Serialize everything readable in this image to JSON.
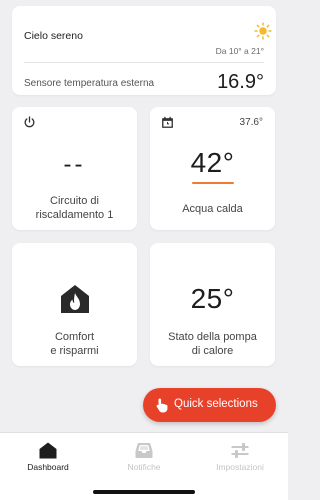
{
  "weather": {
    "condition": "Cielo sereno",
    "range": "Da 10° a 21°",
    "sensor_label": "Sensore temperatura esterna",
    "sensor_value": "16.9°",
    "icon": "sun-icon"
  },
  "tiles": [
    {
      "icon": "power-icon",
      "value": "--",
      "label_line1": "Circuito di",
      "label_line2": "riscaldamento 1"
    },
    {
      "icon": "calendar-clock-icon",
      "corner": "37.6°",
      "value": "42°",
      "label": "Acqua calda",
      "accent": "#f07c34"
    },
    {
      "icon": "house-flame-icon",
      "label_line1": "Comfort",
      "label_line2": "e risparmi"
    },
    {
      "value": "25°",
      "label_line1": "Stato della pompa",
      "label_line2": "di calore"
    }
  ],
  "fab": {
    "label": "Quick selections",
    "icon": "hand-pointer-icon",
    "color": "#e8412a"
  },
  "nav": [
    {
      "label": "Dashboard",
      "icon": "home-icon",
      "active": true
    },
    {
      "label": "Notifiche",
      "icon": "inbox-icon",
      "active": false
    },
    {
      "label": "Impostazioni",
      "icon": "sliders-icon",
      "active": false
    }
  ]
}
